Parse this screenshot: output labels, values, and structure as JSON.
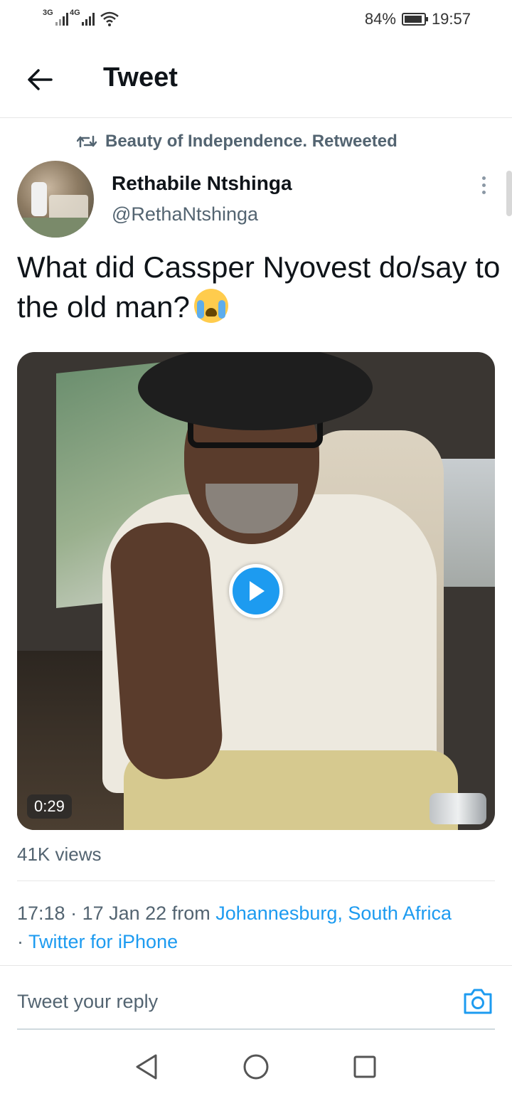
{
  "status_bar": {
    "signal1_label": "3G",
    "signal2_label": "4G",
    "battery": "84%",
    "time": "19:57",
    "icons": [
      "signal-icon",
      "wifi-icon",
      "battery-icon"
    ]
  },
  "header": {
    "title": "Tweet",
    "back_icon": "arrow-left-icon"
  },
  "retweet": {
    "text": "Beauty of Independence. Retweeted",
    "icon": "retweet-icon"
  },
  "tweet": {
    "display_name": "Rethabile Ntshinga",
    "handle": "@RethaNtshinga",
    "text": "What did Cassper Nyovest do/say to the old man?",
    "emoji": "loudly-crying-face",
    "video_duration": "0:29",
    "views": "41K views",
    "time": "17:18",
    "date": "17 Jan 22",
    "from_label": "from",
    "location": "Johannesburg, South Africa",
    "client": "Twitter for iPhone"
  },
  "reply": {
    "placeholder": "Tweet your reply",
    "camera_icon": "camera-icon"
  },
  "colors": {
    "accent": "#1d9bf0",
    "secondary_text": "#536471",
    "primary_text": "#0f1419"
  },
  "nav": {
    "icons": [
      "back-triangle-icon",
      "home-circle-icon",
      "recents-square-icon"
    ]
  }
}
